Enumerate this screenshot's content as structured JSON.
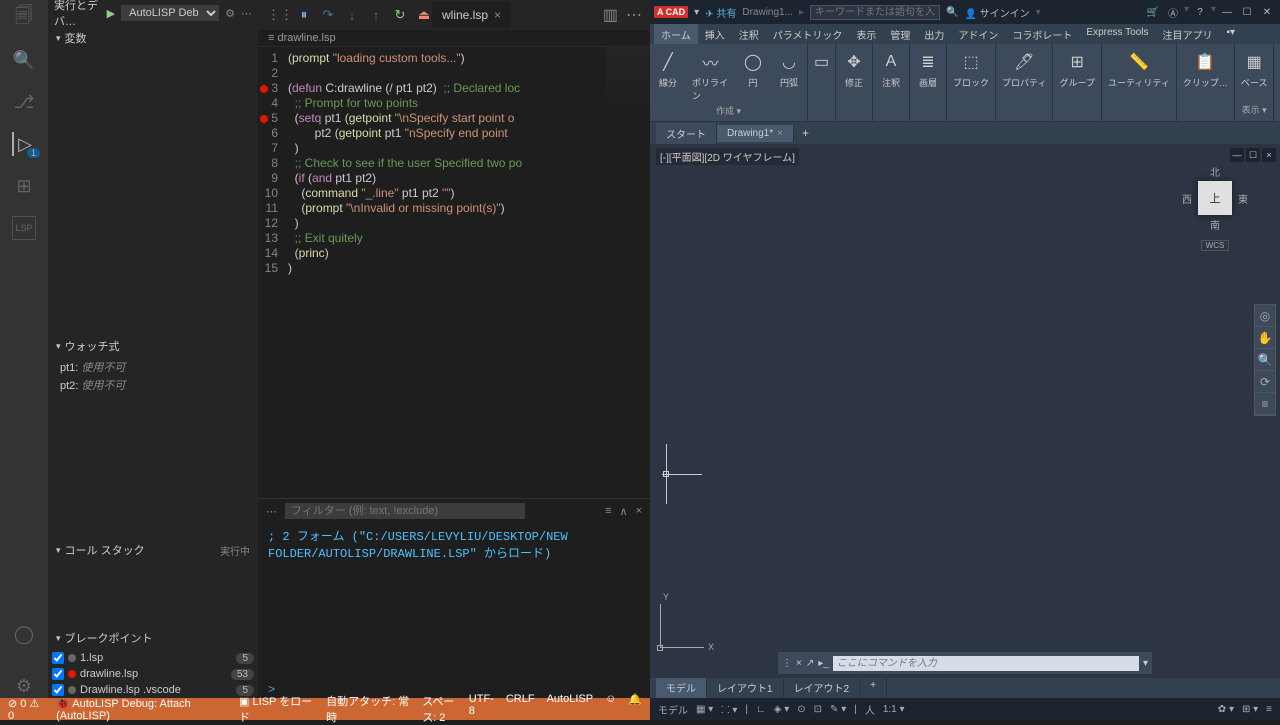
{
  "vs": {
    "top": {
      "label": "実行とデバ…",
      "config": "AutoLISP Deb"
    },
    "tabs": {
      "file": "wline.lsp"
    },
    "crumb": "drawline.lsp",
    "sections": {
      "vars": "変数",
      "watch": "ウォッチ式",
      "callstack": "コール スタック",
      "callstack_state": "実行中",
      "bps": "ブレークポイント"
    },
    "watch": [
      {
        "name": "pt1:",
        "val": "使用不可"
      },
      {
        "name": "pt2:",
        "val": "使用不可"
      }
    ],
    "bps": [
      {
        "dot": "gray",
        "name": "1.lsp",
        "cnt": "5",
        "chk": true
      },
      {
        "dot": "red",
        "name": "drawline.lsp",
        "cnt": "53",
        "chk": true
      },
      {
        "dot": "gray",
        "name": "Drawline.lsp  .vscode",
        "cnt": "5",
        "chk": true
      }
    ],
    "code": [
      {
        "n": 1,
        "bp": false,
        "html": "(<span class='fn'>prompt</span> <span class='st'>\"loading custom tools...\"</span>)"
      },
      {
        "n": 2,
        "bp": false,
        "html": ""
      },
      {
        "n": 3,
        "bp": true,
        "html": "(<span class='kw'>defun</span> C:drawline (/ pt1 pt2)  <span class='cm'>;; Declared loc</span>"
      },
      {
        "n": 4,
        "bp": false,
        "html": "  <span class='cm'>;; Prompt for two points</span>"
      },
      {
        "n": 5,
        "bp": true,
        "html": "  (<span class='kw'>setq</span> pt1 (<span class='fn'>getpoint</span> <span class='st'>\"\\nSpecify start point o</span>"
      },
      {
        "n": 6,
        "bp": false,
        "html": "        pt2 (<span class='fn'>getpoint</span> pt1 <span class='st'>\"nSpecify end point </span>"
      },
      {
        "n": 7,
        "bp": false,
        "html": "  )"
      },
      {
        "n": 8,
        "bp": false,
        "html": "  <span class='cm'>;; Check to see if the user Specified two po</span>"
      },
      {
        "n": 9,
        "bp": false,
        "html": "  (<span class='kw'>if</span> (<span class='kw'>and</span> pt1 pt2)"
      },
      {
        "n": 10,
        "bp": false,
        "html": "    (<span class='fn'>command</span> <span class='st'>\"_.line\"</span> pt1 pt2 <span class='st'>\"\"</span>)"
      },
      {
        "n": 11,
        "bp": false,
        "html": "    (<span class='fn'>prompt</span> <span class='st'>\"\\nInvalid or missing point(s)\"</span>)"
      },
      {
        "n": 12,
        "bp": false,
        "html": "  )"
      },
      {
        "n": 13,
        "bp": false,
        "html": "  <span class='cm'>;; Exit quitely</span>"
      },
      {
        "n": 14,
        "bp": false,
        "html": "  (<span class='fn'>princ</span>)"
      },
      {
        "n": 15,
        "bp": false,
        "html": ")"
      }
    ],
    "console": {
      "filter_ph": "フィルター (例: text, !exclude)",
      "out": "; 2 フォーム (\"C:/USERS/LEVYLIU/DESKTOP/NEW FOLDER/AUTOLISP/DRAWLINE.LSP\" からロード)",
      "prompt": ">"
    },
    "status": {
      "err": "⊘ 0 ⚠ 0",
      "dbg": "AutoLISP Debug: Attach (AutoLISP)",
      "lisp": "LISP をロード",
      "auto": "自動アタッチ: 常時",
      "space": "スペース: 2",
      "enc": "UTF-8",
      "eol": "CRLF",
      "lang": "AutoLISP"
    }
  },
  "ac": {
    "title": {
      "logo": "A CAD",
      "share": "共有",
      "dwg": "Drawing1...",
      "search_ph": "キーワードまたは語句を入力",
      "signin": "サインイン"
    },
    "menu": [
      "ホーム",
      "挿入",
      "注釈",
      "パラメトリック",
      "表示",
      "管理",
      "出力",
      "アドイン",
      "コラボレート",
      "Express Tools",
      "注目アプリ"
    ],
    "ribbon": {
      "draw": {
        "items": [
          "線分",
          "ポリライン",
          "円",
          "円弧"
        ],
        "name": "作成 ▾"
      },
      "mod": {
        "label": "修正"
      },
      "ann": {
        "label": "注釈"
      },
      "lay": {
        "label": "画層"
      },
      "blk": {
        "label": "ブロック"
      },
      "prop": {
        "label": "プロパティ"
      },
      "grp": {
        "label": "グループ"
      },
      "util": {
        "label": "ユーティリティ"
      },
      "clip": {
        "label": "クリップ…"
      },
      "base": {
        "label": "ベース"
      },
      "view": {
        "label": "表示 ▾"
      }
    },
    "filetabs": {
      "start": "スタート",
      "dwg": "Drawing1*"
    },
    "viewlabel": "[-][平面図][2D ワイヤフレーム]",
    "viewcube": {
      "n": "北",
      "s": "南",
      "e": "東",
      "w": "西",
      "top": "上",
      "wcs": "WCS"
    },
    "cmdline_ph": "ここにコマンドを入力",
    "layouts": [
      "モデル",
      "レイアウト1",
      "レイアウト2"
    ],
    "status": {
      "model": "モデル",
      "scale": "1:1 ▾"
    }
  }
}
